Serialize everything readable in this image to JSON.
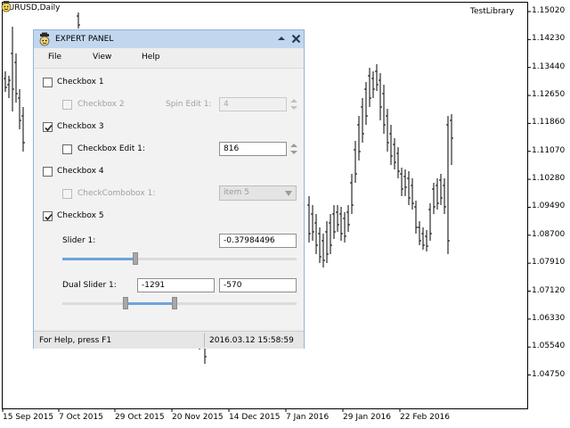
{
  "chart": {
    "symbol": "EURUSD,Daily",
    "expert_name": "TestLibrary",
    "expert_icon": "smiley-ea-icon",
    "prices": [
      "1.15020",
      "1.14230",
      "1.13440",
      "1.12650",
      "1.11860",
      "1.11070",
      "1.10280",
      "1.09490",
      "1.08700",
      "1.07910",
      "1.07120",
      "1.06330",
      "1.05540",
      "1.04750"
    ],
    "dates": [
      "15 Sep 2015",
      "7 Oct 2015",
      "29 Oct 2015",
      "20 Nov 2015",
      "14 Dec 2015",
      "7 Jan 2016",
      "29 Jan 2016",
      "22 Feb 2016"
    ]
  },
  "panel": {
    "title": "EXPERT PANEL",
    "menu": [
      "File",
      "View",
      "Help"
    ],
    "checkbox1": {
      "label": "Checkbox 1",
      "checked": false
    },
    "checkbox2": {
      "label": "Checkbox 2",
      "checked": false,
      "enabled": false
    },
    "spin_edit1": {
      "label": "Spin Edit 1:",
      "value": "4",
      "enabled": false
    },
    "checkbox3": {
      "label": "Checkbox 3",
      "checked": true
    },
    "checkbox_edit1": {
      "label": "Checkbox Edit 1:",
      "value": "816",
      "checked": false
    },
    "checkbox4": {
      "label": "Checkbox 4",
      "checked": false
    },
    "checkcombobox1": {
      "label": "CheckCombobox 1:",
      "value": "item 5",
      "enabled": false
    },
    "checkbox5": {
      "label": "Checkbox 5",
      "checked": true
    },
    "slider1": {
      "label": "Slider 1:",
      "value": "-0.37984496",
      "fraction": 0.31
    },
    "dual_slider1": {
      "label": "Dual Slider 1:",
      "low_value": "-1291",
      "high_value": "-570",
      "low_fraction": 0.27,
      "high_fraction": 0.48
    },
    "status": {
      "help": "For Help, press F1",
      "datetime": "2016.03.12 15:58:59"
    }
  }
}
